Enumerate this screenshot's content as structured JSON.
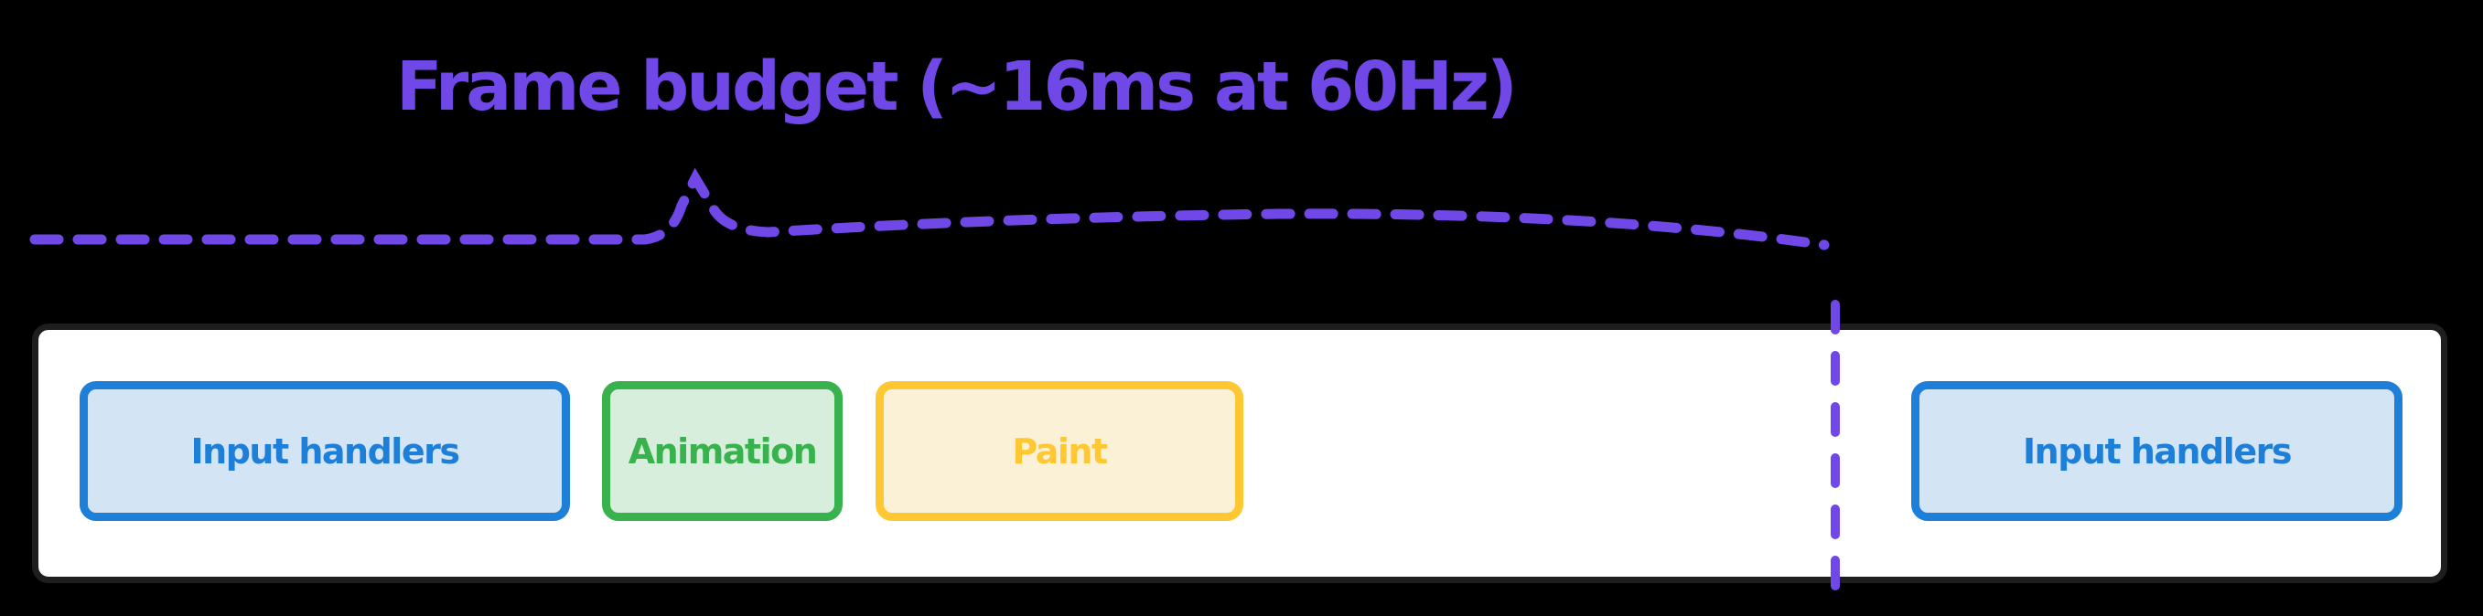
{
  "annotation": {
    "label": "Frame budget (~16ms at 60Hz)",
    "color": "#7048e8"
  },
  "blocks": [
    {
      "label": "Input handlers",
      "kind": "blue"
    },
    {
      "label": "Animation",
      "kind": "green"
    },
    {
      "label": "Paint",
      "kind": "yellow"
    },
    {
      "label": "Input handlers",
      "kind": "blue"
    }
  ],
  "colors": {
    "blue": "#1e7fd8",
    "green": "#37b24d",
    "yellow": "#ffc832",
    "purple": "#7048e8"
  }
}
